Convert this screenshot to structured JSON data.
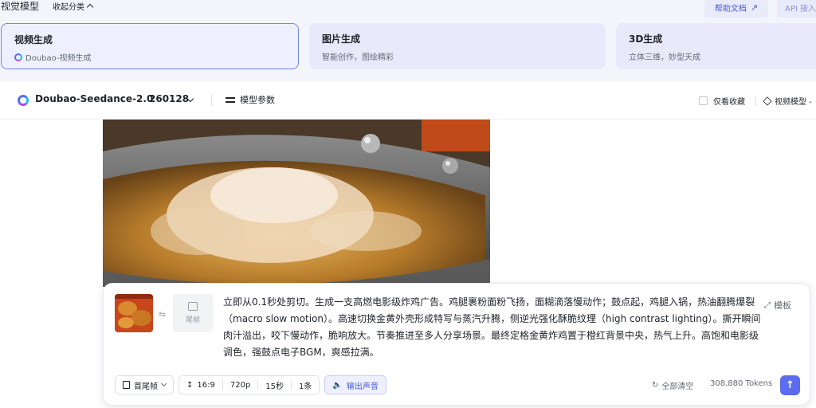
{
  "header": {
    "title": "视觉模型",
    "collapse_label": "收起分类",
    "help_label": "帮助文档",
    "api_label": "API 接入"
  },
  "categories": [
    {
      "title": "视频生成",
      "subtitle": "Doubao-视频生成"
    },
    {
      "title": "图片生成",
      "subtitle": "智能创作，图绘精彩"
    },
    {
      "title": "3D生成",
      "subtitle": "立体三维，妙型天成"
    }
  ],
  "model_bar": {
    "model_name": "Doubao-Seedance-2.0",
    "model_version": "260128",
    "params_label": "模型参数",
    "favorites_label": "仅看收藏",
    "video_model_label": "视频模型 -"
  },
  "prompt": {
    "tail_frame_label": "尾帧",
    "text": "立即从0.1秒处剪切。生成一支高燃电影级炸鸡广告。鸡腿裹粉面粉飞扬，面糊滴落慢动作；鼓点起，鸡腿入锅，热油翻腾爆裂（macro slow motion）。高速切换金黄外壳形成特写与蒸汽升腾，侧逆光强化酥脆纹理（high contrast lighting）。撕开瞬间肉汁溢出，咬下慢动作，脆响放大。节奏推进至多人分享场景。最终定格金黄炸鸡置于橙红背景中央，热气上升。高饱和电影级调色，强鼓点电子BGM，爽感拉满。",
    "template_label": "模板"
  },
  "toolbar": {
    "frame_mode": "首尾帧",
    "ratio": "16:9",
    "resolution": "720p",
    "duration": "15秒",
    "count": "1条",
    "sound_label": "输出声音",
    "clear_label": "全部清空",
    "tokens": "308,880 Tokens"
  },
  "colors": {
    "accent": "#5b6cf0",
    "selected_card_border": "#6f86f2"
  }
}
